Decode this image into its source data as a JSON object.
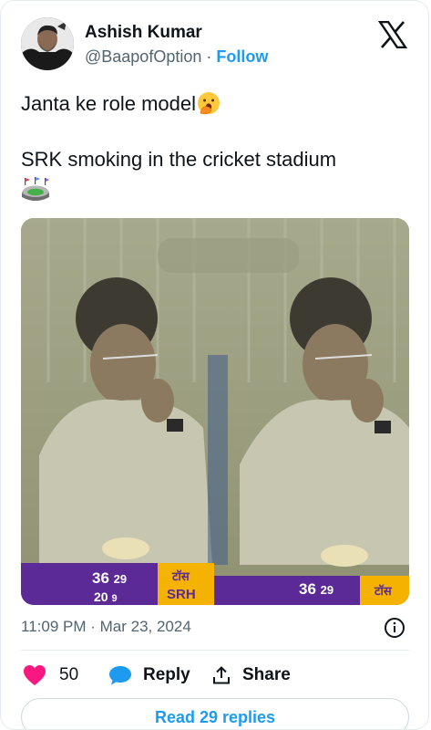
{
  "author": {
    "name": "Ashish Kumar",
    "handle": "@BaapofOption",
    "separator": " · ",
    "follow_label": "Follow"
  },
  "tweet": {
    "line1": "Janta ke role model",
    "line2": "SRK smoking in the cricket stadium",
    "emoji_1": "face-with-hand-over-mouth",
    "emoji_2": "stadium"
  },
  "media": {
    "panels": [
      {
        "score": "36",
        "overs": "29",
        "toss_label": "टॉस",
        "team": "SRH",
        "score_row2": "20",
        "overs_row2": "9"
      },
      {
        "score": "36",
        "overs": "29",
        "toss_label": "टॉस"
      }
    ]
  },
  "meta": {
    "time": "11:09 PM",
    "separator": " · ",
    "date": "Mar 23, 2024"
  },
  "actions": {
    "likes": "50",
    "reply_label": "Reply",
    "share_label": "Share"
  },
  "read_replies_label": "Read 29 replies",
  "colors": {
    "accent": "#1d9bf0",
    "like": "#f91880",
    "text": "#0f1419",
    "muted": "#536471",
    "scorebar": "#5b2a97",
    "toss": "#f5b200"
  }
}
